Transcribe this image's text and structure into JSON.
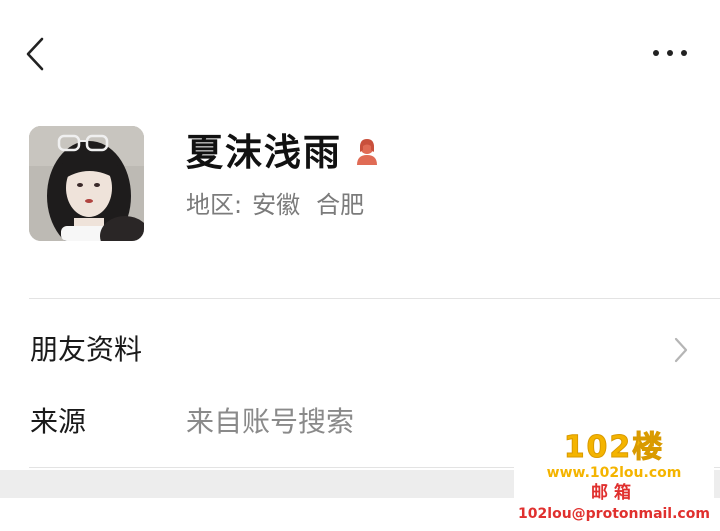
{
  "header": {
    "back_icon": "chevron-left-icon",
    "more_icon": "more-horizontal-icon"
  },
  "profile": {
    "name": "夏沫浅雨",
    "gender_icon": "female-person-icon",
    "gender_color": "#e06b55",
    "region_label": "地区:",
    "region_province": "安徽",
    "region_city": "合肥"
  },
  "rows": {
    "friend_info_label": "朋友资料",
    "source_label": "来源",
    "source_value": "来自账号搜索"
  },
  "watermark": {
    "title": "102楼",
    "site": "www.102lou.com",
    "mail_label": "邮箱",
    "address": "102lou@protonmail.com"
  }
}
